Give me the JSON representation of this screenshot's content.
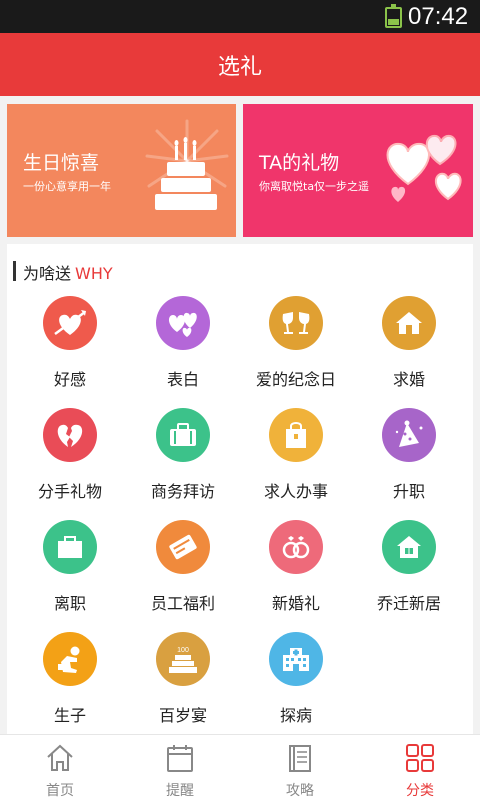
{
  "status": {
    "time": "07:42"
  },
  "header": {
    "title": "选礼"
  },
  "banners": [
    {
      "title": "生日惊喜",
      "subtitle": "一份心意享用一年",
      "icon": "birthday-cake-icon",
      "color": "#f3875d"
    },
    {
      "title": "TA的礼物",
      "subtitle": "你离取悦ta仅一步之遥",
      "icon": "hearts-icon",
      "color": "#f0356b"
    }
  ],
  "why": {
    "label": "为啥送",
    "label_en": "WHY",
    "items": [
      {
        "label": "好感",
        "icon": "heart-arrow-icon",
        "color": "#ef5a4c"
      },
      {
        "label": "表白",
        "icon": "hearts-icon",
        "color": "#b467d8"
      },
      {
        "label": "爱的纪念日",
        "icon": "wine-glasses-icon",
        "color": "#e0a032"
      },
      {
        "label": "求婚",
        "icon": "house-icon",
        "color": "#e0a032"
      },
      {
        "label": "分手礼物",
        "icon": "broken-heart-icon",
        "color": "#e94c57"
      },
      {
        "label": "商务拜访",
        "icon": "briefcase-icon",
        "color": "#3cc28a"
      },
      {
        "label": "求人办事",
        "icon": "gift-bag-icon",
        "color": "#f0b23a"
      },
      {
        "label": "升职",
        "icon": "party-hat-icon",
        "color": "#a765c9"
      },
      {
        "label": "离职",
        "icon": "box-icon",
        "color": "#3cc28a"
      },
      {
        "label": "员工福利",
        "icon": "wallet-icon",
        "color": "#f08a3c"
      },
      {
        "label": "新婚礼",
        "icon": "rings-icon",
        "color": "#ee6a7a"
      },
      {
        "label": "乔迁新居",
        "icon": "new-house-icon",
        "color": "#3cc28a"
      },
      {
        "label": "生子",
        "icon": "baby-icon",
        "color": "#f3a116"
      },
      {
        "label": "百岁宴",
        "icon": "cake-100-icon",
        "color": "#d9a040"
      },
      {
        "label": "探病",
        "icon": "hospital-icon",
        "color": "#4fb6e6"
      }
    ]
  },
  "tabs": [
    {
      "label": "首页",
      "icon": "home-icon"
    },
    {
      "label": "提醒",
      "icon": "calendar-icon"
    },
    {
      "label": "攻略",
      "icon": "notebook-icon"
    },
    {
      "label": "分类",
      "icon": "category-grid-icon",
      "active": true
    }
  ],
  "colors": {
    "accent": "#e83a3a",
    "status_bar": "#1a1a1a",
    "battery": "#8bc34a"
  }
}
